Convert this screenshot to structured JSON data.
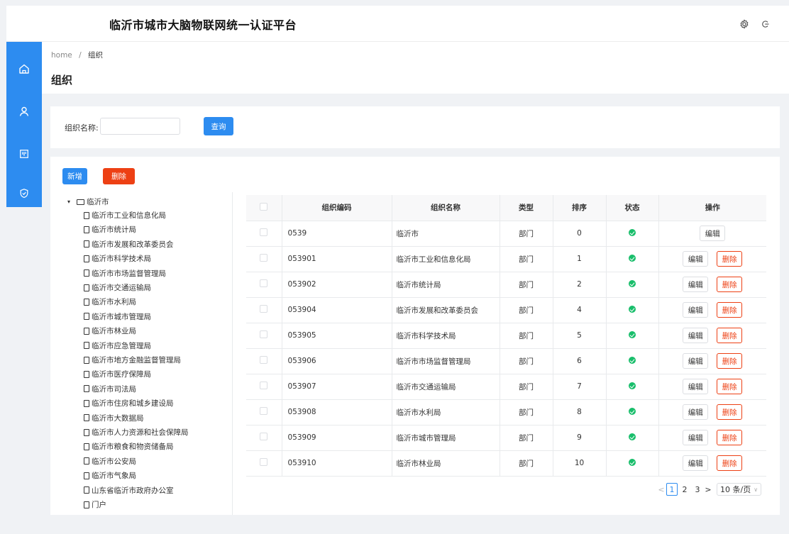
{
  "header": {
    "title": "临沂市城市大脑物联网统一认证平台"
  },
  "breadcrumb": {
    "home": "home",
    "sep": "/",
    "current": "组织"
  },
  "page_title": "组织",
  "search": {
    "label": "组织名称:",
    "value": "",
    "button": "查询"
  },
  "toolbar": {
    "add": "新增",
    "delete": "删除"
  },
  "tree": {
    "root": "临沂市",
    "children": [
      "临沂市工业和信息化局",
      "临沂市统计局",
      "临沂市发展和改革委员会",
      "临沂市科学技术局",
      "临沂市市场监督管理局",
      "临沂市交通运输局",
      "临沂市水利局",
      "临沂市城市管理局",
      "临沂市林业局",
      "临沂市应急管理局",
      "临沂市地方金融监督管理局",
      "临沂市医疗保障局",
      "临沂市司法局",
      "临沂市住房和城乡建设局",
      "临沂市大数据局",
      "临沂市人力资源和社会保障局",
      "临沂市粮食和物资储备局",
      "临沂市公安局",
      "临沂市气象局",
      "山东省临沂市政府办公室",
      "门户"
    ]
  },
  "table": {
    "headers": [
      "组织编码",
      "组织名称",
      "类型",
      "排序",
      "状态",
      "操作"
    ],
    "rows": [
      {
        "code": "0539",
        "name": "临沂市",
        "type": "部门",
        "order": "0"
      },
      {
        "code": "053901",
        "name": "临沂市工业和信息化局",
        "type": "部门",
        "order": "1"
      },
      {
        "code": "053902",
        "name": "临沂市统计局",
        "type": "部门",
        "order": "2"
      },
      {
        "code": "053904",
        "name": "临沂市发展和改革委员会",
        "type": "部门",
        "order": "4"
      },
      {
        "code": "053905",
        "name": "临沂市科学技术局",
        "type": "部门",
        "order": "5"
      },
      {
        "code": "053906",
        "name": "临沂市市场监督管理局",
        "type": "部门",
        "order": "6"
      },
      {
        "code": "053907",
        "name": "临沂市交通运输局",
        "type": "部门",
        "order": "7"
      },
      {
        "code": "053908",
        "name": "临沂市水利局",
        "type": "部门",
        "order": "8"
      },
      {
        "code": "053909",
        "name": "临沂市城市管理局",
        "type": "部门",
        "order": "9"
      },
      {
        "code": "053910",
        "name": "临沂市林业局",
        "type": "部门",
        "order": "10"
      }
    ],
    "edit_label": "编辑",
    "delete_label": "删除"
  },
  "pagination": {
    "prev": "<",
    "pages": [
      "1",
      "2",
      "3"
    ],
    "next": ">",
    "page_size": "10 条/页"
  },
  "colors": {
    "primary": "#2d8cf0",
    "danger": "#ed4014",
    "success": "#19be6b"
  },
  "icons": {
    "header": [
      "settings-icon",
      "logout-icon"
    ],
    "sidebar": [
      "home-icon",
      "user-icon",
      "board-icon",
      "shield-icon"
    ]
  }
}
